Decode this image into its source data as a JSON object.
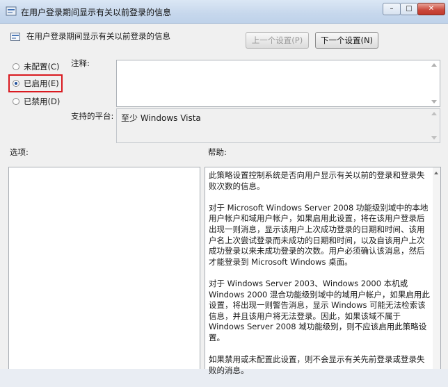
{
  "window": {
    "title": "在用户登录期间显示有关以前登录的信息",
    "icon": "policy-settings-icon",
    "controls": {
      "minimize": "–",
      "maximize": "□",
      "close": "✕"
    }
  },
  "header": {
    "title": "在用户登录期间显示有关以前登录的信息",
    "prev_button": "上一个设置(P)",
    "next_button": "下一个设置(N)"
  },
  "state": {
    "options": [
      {
        "label": "未配置(C)",
        "selected": false
      },
      {
        "label": "已启用(E)",
        "selected": true
      },
      {
        "label": "已禁用(D)",
        "selected": false
      }
    ],
    "highlight_color": "#d9191f"
  },
  "comment": {
    "label": "注释:",
    "value": ""
  },
  "platform": {
    "label": "支持的平台:",
    "value": "至少 Windows Vista"
  },
  "options_label": "选项:",
  "help": {
    "label": "帮助:",
    "paragraphs": [
      "此策略设置控制系统是否向用户显示有关以前的登录和登录失败次数的信息。",
      "对于 Microsoft Windows Server 2008 功能级别域中的本地用户帐户和域用户帐户，如果启用此设置，将在该用户登录后出现一则消息，显示该用户上次成功登录的日期和时间、该用户名上次尝试登录而未成功的日期和时间，以及自该用户上次成功登录以来未成功登录的次数。用户必须确认该消息，然后才能登录到 Microsoft Windows 桌面。",
      "对于 Windows Server 2003、Windows 2000 本机或 Windows 2000 混合功能级别域中的域用户帐户，如果启用此设置，将出现一则警告消息，显示 Windows 可能无法检索该信息，并且该用户将无法登录。因此，如果该域不属于 Windows Server 2008 域功能级别，则不应该启用此策略设置。",
      "如果禁用或未配置此设置，则不会显示有关先前登录或登录失败的消息。"
    ]
  }
}
